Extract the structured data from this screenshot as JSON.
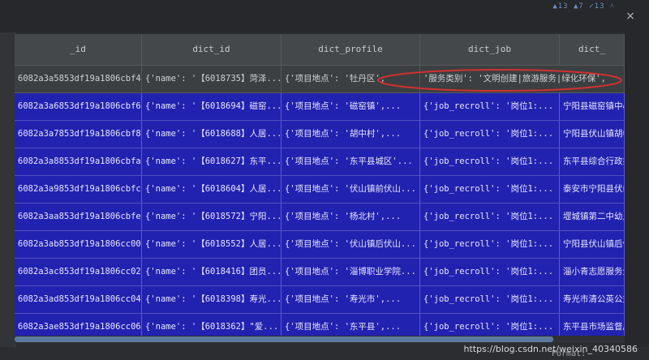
{
  "window": {
    "topbar_hint": "▲13 ▲7 ✓13 ˄",
    "close_icon": "×"
  },
  "table": {
    "columns": [
      "_id",
      "dict_id",
      "dict_profile",
      "dict_job",
      "dict_"
    ],
    "first_row": {
      "_id": "6082a3a5853df19a1806cbf4",
      "dict_id": "{'name': '【6018735】菏泽...",
      "dict_profile": "{'项目地点': '牡丹区',",
      "dict_job": "'服务类别': '文明创建|旅游服务|绿化环保',",
      "dict_extra": "'服务对象': '"
    },
    "rows": [
      {
        "_id": "6082a3a6853df19a1806cbf6",
        "dict_id": "{'name': '【6018694】磁窑...",
        "dict_profile": "{'项目地点': '磁窑镇',...",
        "dict_job": "{'job_recroll': '岗位1:...",
        "dict_extra": "宁阳县磁窑镇中心"
      },
      {
        "_id": "6082a3a7853df19a1806cbf8",
        "dict_id": "{'name': '【6018688】人居...",
        "dict_profile": "{'项目地点': '胡中村',...",
        "dict_job": "{'job_recroll': '岗位1:...",
        "dict_extra": "宁阳县伏山镇胡中"
      },
      {
        "_id": "6082a3a8853df19a1806cbfa",
        "dict_id": "{'name': '【6018627】东平...",
        "dict_profile": "{'项目地点': '东平县城区'...",
        "dict_job": "{'job_recroll': '岗位1:...",
        "dict_extra": "东平县综合行政执"
      },
      {
        "_id": "6082a3a9853df19a1806cbfc",
        "dict_id": "{'name': '【6018604】人居...",
        "dict_profile": "{'项目地点': '伏山镇前伏山...",
        "dict_job": "{'job_recroll': '岗位1:...",
        "dict_extra": "泰安市宁阳县伏山"
      },
      {
        "_id": "6082a3aa853df19a1806cbfe",
        "dict_id": "{'name': '【6018572】宁阳...",
        "dict_profile": "{'项目地点': '杨北村',...",
        "dict_job": "{'job_recroll': '岗位1:...",
        "dict_extra": "堽城镇第二中幼儿"
      },
      {
        "_id": "6082a3ab853df19a1806cc00",
        "dict_id": "{'name': '【6018552】人居...",
        "dict_profile": "{'项目地点': '伏山镇后伏山...",
        "dict_job": "{'job_recroll': '岗位1:...",
        "dict_extra": "宁阳县伏山镇后伏"
      },
      {
        "_id": "6082a3ac853df19a1806cc02",
        "dict_id": "{'name': '【6018416】团员...",
        "dict_profile": "{'项目地点': '淄博职业学院...",
        "dict_job": "{'job_recroll': '岗位1:...",
        "dict_extra": "淄小青志愿服务生"
      },
      {
        "_id": "6082a3ad853df19a1806cc04",
        "dict_id": "{'name': '【6018398】寿光...",
        "dict_profile": "{'项目地点': '寿光市',...",
        "dict_job": "{'job_recroll': '岗位1:...",
        "dict_extra": "寿光市清公英公益"
      },
      {
        "_id": "6082a3ae853df19a1806cc06",
        "dict_id": "{'name': '【6018362】\"爱...",
        "dict_profile": "{'项目地点': '东平县',...",
        "dict_job": "{'job_recroll': '岗位1:...",
        "dict_extra": "东平县市场监督局"
      }
    ]
  },
  "statusbar": {
    "format_label": "Format:",
    "watermark": "https://blog.csdn.net/weixin_40340586"
  },
  "colors": {
    "selection": "#2222b0",
    "annotation": "#d23030"
  }
}
